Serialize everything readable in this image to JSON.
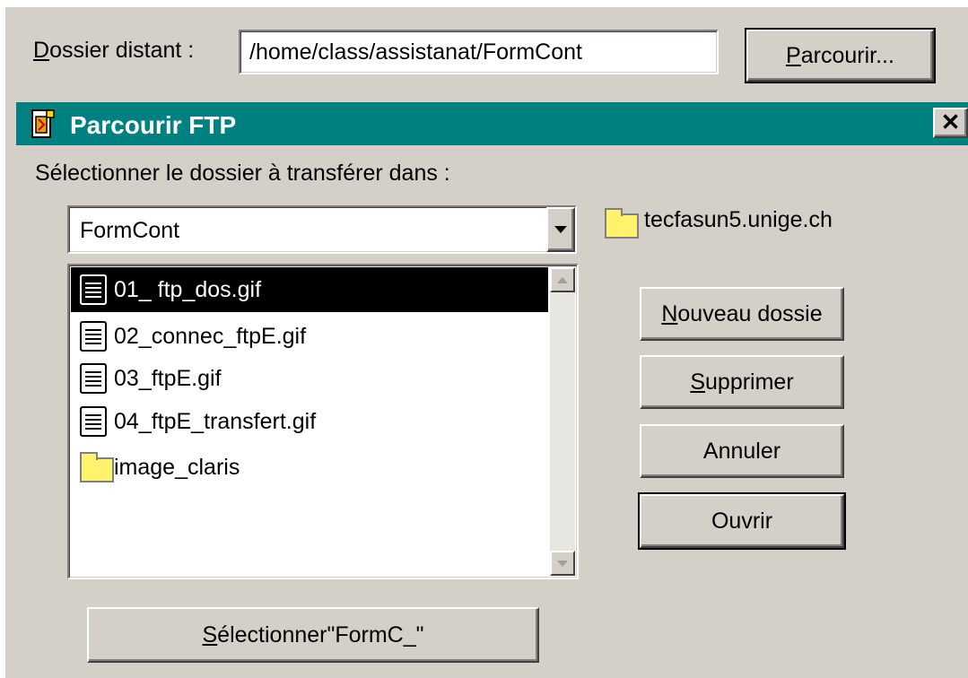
{
  "remote_folder": {
    "label": "Dossier distant :",
    "value": "/home/class/assistanat/FormCont",
    "browse_button": "Parcourir..."
  },
  "dialog": {
    "title": "Parcourir FTP",
    "close_glyph": "✕",
    "prompt": "Sélectionner le dossier à transférer dans :",
    "folder_select_value": "FormCont",
    "server_name": "tecfasun5.unige.ch",
    "files": [
      {
        "name": "01_ ftp_dos.gif",
        "type": "file",
        "selected": true
      },
      {
        "name": "02_connec_ftpE.gif",
        "type": "file",
        "selected": false
      },
      {
        "name": "03_ftpE.gif",
        "type": "file",
        "selected": false
      },
      {
        "name": "04_ftpE_transfert.gif",
        "type": "file",
        "selected": false
      },
      {
        "name": "image_claris",
        "type": "folder",
        "selected": false
      }
    ],
    "buttons": {
      "new_folder": "Nouveau dossie",
      "delete": "Supprimer",
      "cancel": "Annuler",
      "open": "Ouvrir"
    },
    "select_button": "Sélectionner\"FormC_\""
  },
  "colors": {
    "titlebar": "#008080",
    "face": "#d4d0c8",
    "folder": "#fff36e"
  },
  "icons": {
    "title": "ftp-document-icon",
    "file": "document-icon",
    "folder": "folder-icon"
  }
}
